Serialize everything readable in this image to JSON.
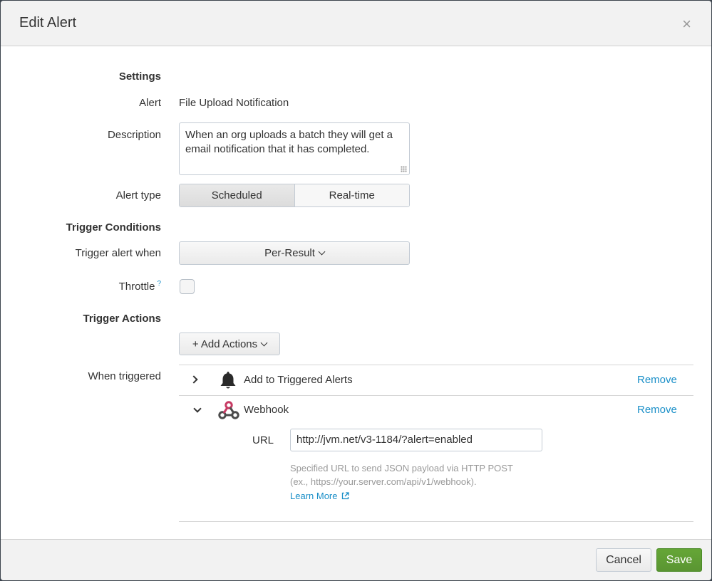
{
  "modal": {
    "title": "Edit Alert",
    "close_glyph": "×"
  },
  "settings": {
    "heading": "Settings",
    "alert_label": "Alert",
    "alert_value": "File Upload Notification",
    "description_label": "Description",
    "description_value": "When an org uploads a batch they will get a email notification that it has completed.",
    "alert_type_label": "Alert type",
    "alert_type_options": [
      "Scheduled",
      "Real-time"
    ],
    "alert_type_selected": "Scheduled"
  },
  "trigger_conditions": {
    "heading": "Trigger Conditions",
    "trigger_when_label": "Trigger alert when",
    "trigger_when_value": "Per-Result",
    "throttle_label": "Throttle",
    "throttle_help_mark": "?",
    "throttle_checked": false
  },
  "trigger_actions": {
    "heading": "Trigger Actions",
    "add_actions_label": "+ Add Actions",
    "when_triggered_label": "When triggered",
    "actions": [
      {
        "name": "Add to Triggered Alerts",
        "icon": "bell-icon",
        "expanded": false,
        "remove_label": "Remove"
      },
      {
        "name": "Webhook",
        "icon": "webhook-icon",
        "expanded": true,
        "remove_label": "Remove"
      }
    ],
    "webhook": {
      "url_label": "URL",
      "url_value": "http://jvm.net/v3-1184/?alert=enabled",
      "help_line1": "Specified URL to send JSON payload via HTTP POST",
      "help_line2": "(ex., https://your.server.com/api/v1/webhook).",
      "learn_more": "Learn More",
      "external_icon": "external-link-icon"
    }
  },
  "footer": {
    "cancel_label": "Cancel",
    "save_label": "Save"
  },
  "colors": {
    "primary": "#5a9a32",
    "link": "#1a8fc8",
    "header_bg": "#f2f2f2"
  }
}
